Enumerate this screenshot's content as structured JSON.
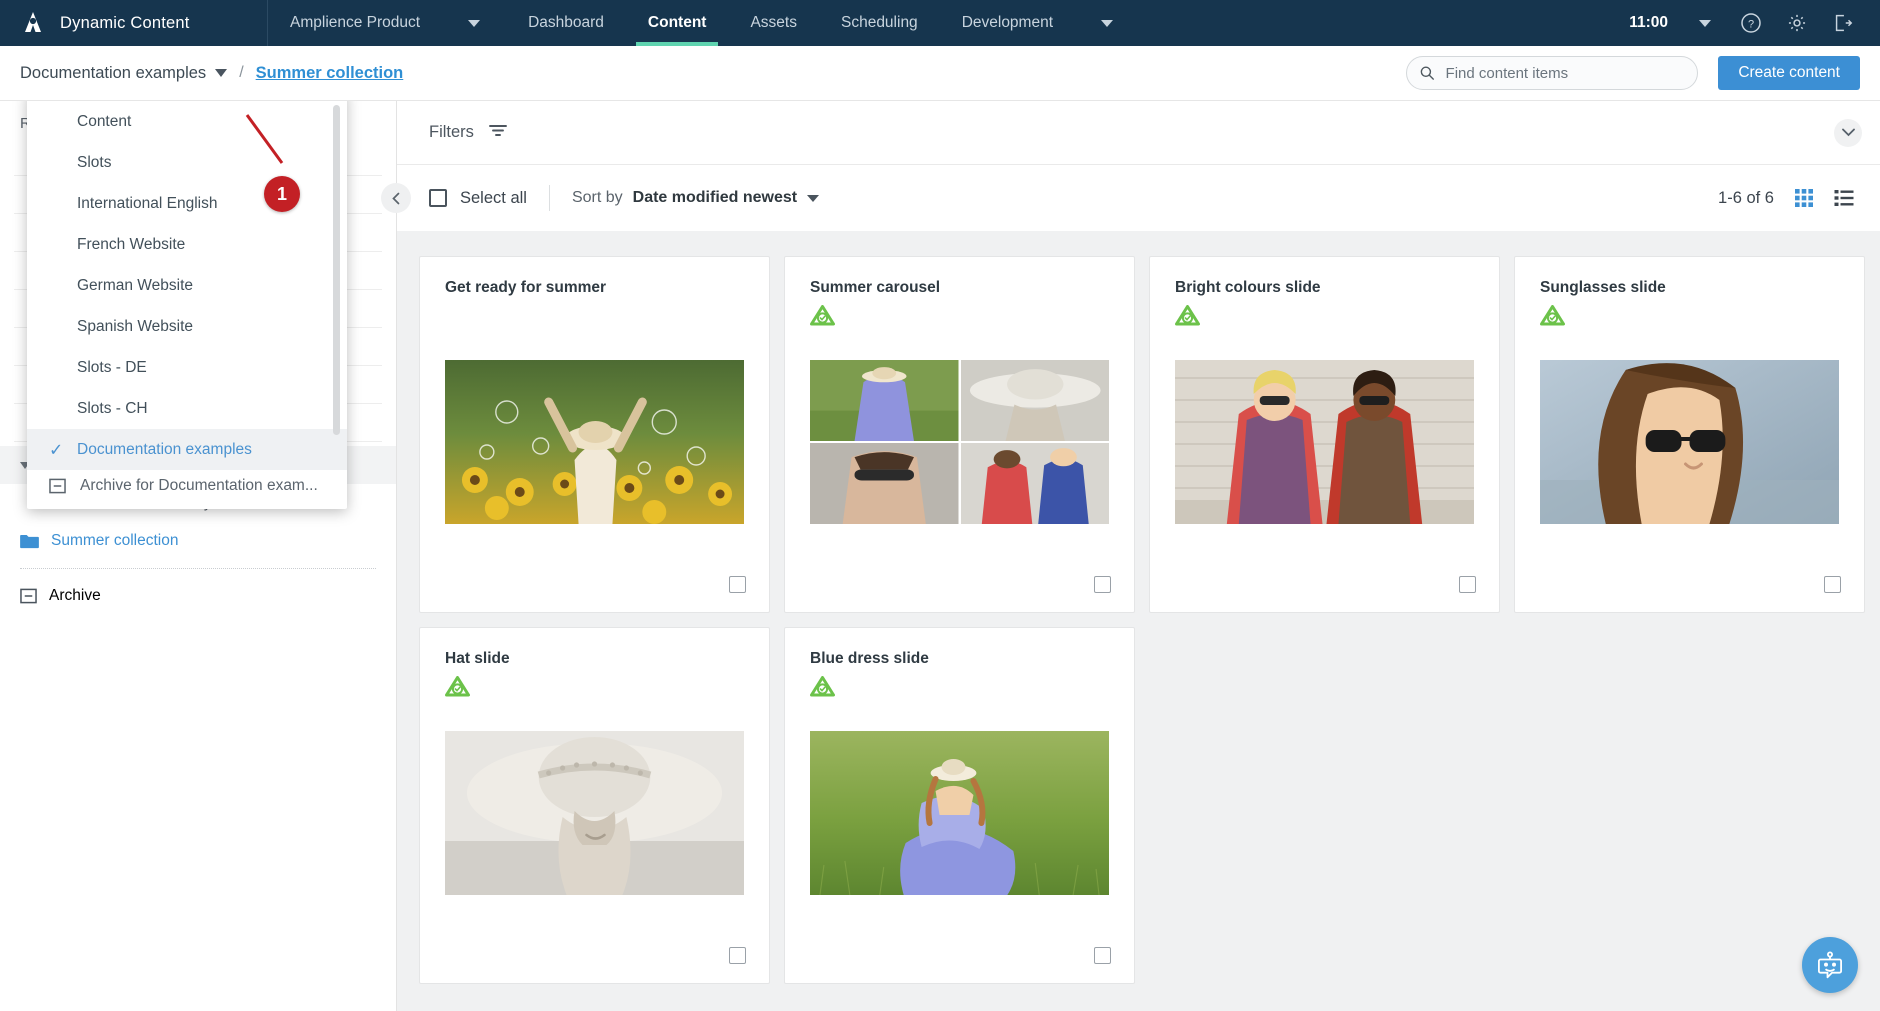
{
  "topbar": {
    "brand": "Dynamic Content",
    "product": "Amplience Product",
    "nav": [
      {
        "label": "Dashboard",
        "active": false
      },
      {
        "label": "Content",
        "active": true
      },
      {
        "label": "Assets",
        "active": false
      },
      {
        "label": "Scheduling",
        "active": false
      },
      {
        "label": "Development",
        "active": false
      }
    ],
    "clock": "11:00",
    "icons": [
      "help-icon",
      "settings-icon",
      "logout-icon"
    ]
  },
  "breadcrumb": {
    "root": "Documentation examples",
    "separator": "/",
    "current": "Summer collection"
  },
  "search": {
    "placeholder": "Find content items",
    "value": ""
  },
  "create_button": "Create content",
  "callout": {
    "number": "1"
  },
  "repository_dropdown": {
    "items": [
      {
        "label": "Content",
        "selected": false
      },
      {
        "label": "Slots",
        "selected": false
      },
      {
        "label": "International English",
        "selected": false
      },
      {
        "label": "French Website",
        "selected": false
      },
      {
        "label": "German Website",
        "selected": false
      },
      {
        "label": "Spanish Website",
        "selected": false
      },
      {
        "label": "Slots - DE",
        "selected": false
      },
      {
        "label": "Slots - CH",
        "selected": false
      },
      {
        "label": "Documentation examples",
        "selected": true
      }
    ],
    "footer": "Archive for Documentation exam..."
  },
  "sidebar": {
    "heading": "R",
    "tree": [
      {
        "label": "Documentation examples",
        "type": "header"
      },
      {
        "label": "DC Extension Personify",
        "type": "child"
      },
      {
        "label": "Summer collection",
        "type": "child-link"
      }
    ],
    "archive": "Archive"
  },
  "filterbar": {
    "filters_label": "Filters"
  },
  "toolbar": {
    "select_all": "Select all",
    "sort_label": "Sort by",
    "sort_value": "Date modified newest",
    "count": "1-6 of 6",
    "views": [
      "grid-view-icon",
      "list-view-icon"
    ],
    "active_view": "grid"
  },
  "cards": [
    {
      "title": "Get ready for summer",
      "published": false,
      "thumb": "sunflower-woman"
    },
    {
      "title": "Summer carousel",
      "published": true,
      "thumb": "mosaic"
    },
    {
      "title": "Bright colours slide",
      "published": true,
      "thumb": "two-women-bright"
    },
    {
      "title": "Sunglasses slide",
      "published": true,
      "thumb": "sunglasses-woman"
    },
    {
      "title": "Hat slide",
      "published": true,
      "thumb": "hat-bw"
    },
    {
      "title": "Blue dress slide",
      "published": true,
      "thumb": "blue-dress-grass"
    }
  ],
  "chat": {
    "icon": "chatbot-icon"
  },
  "colors": {
    "topbar_bg": "#16354e",
    "accent_green": "#5fd4b0",
    "link_blue": "#2f8fd4",
    "primary_button": "#3c8fd4",
    "published_green": "#6cc24a",
    "callout_red": "#c32025"
  }
}
